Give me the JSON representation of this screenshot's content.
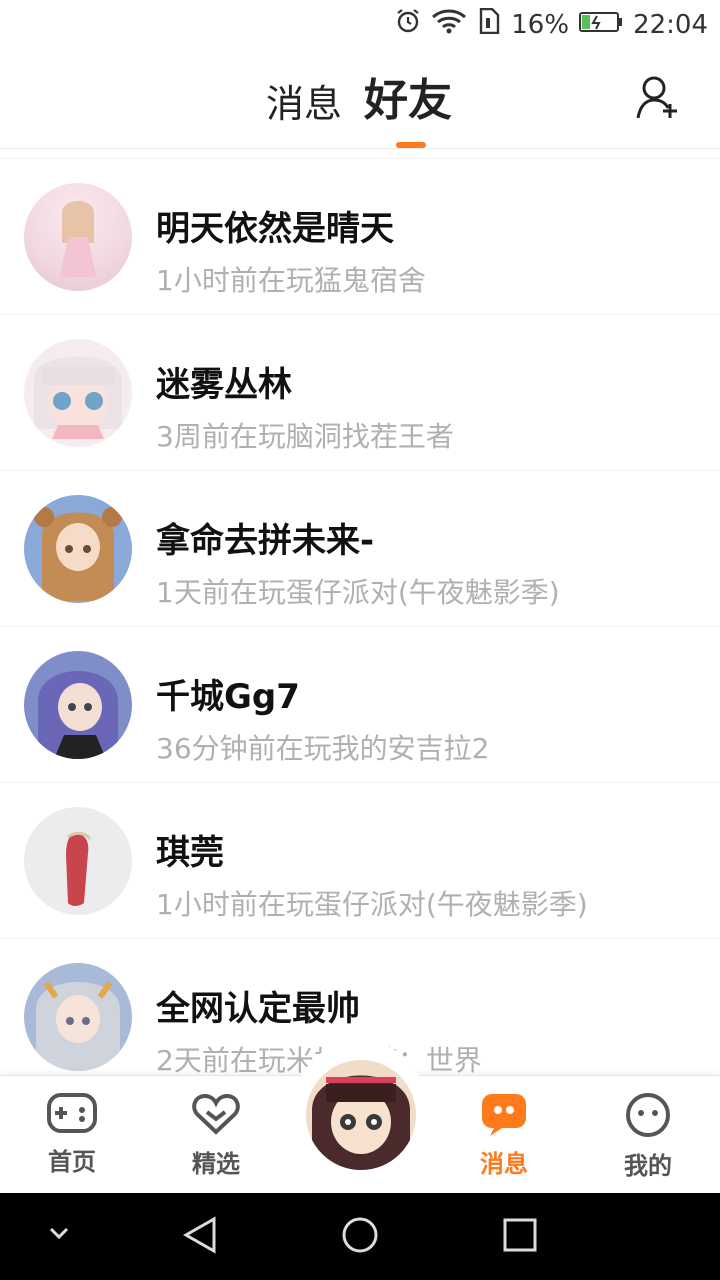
{
  "status_bar": {
    "battery": "16%",
    "time": "22:04",
    "icons": [
      "alarm-icon",
      "wifi-icon",
      "sim-icon",
      "battery-icon"
    ]
  },
  "header": {
    "tabs": [
      {
        "label": "消息"
      },
      {
        "label": "好友"
      }
    ],
    "active_tab": "好友",
    "add_friend_icon": "add-user-icon",
    "accent": "#ff7a1a"
  },
  "friends": [
    {
      "name": "明天依然是晴天",
      "status": "1小时前在玩猛鬼宿舍",
      "avatar_color": "#f2d9e1"
    },
    {
      "name": "迷雾丛林",
      "status": "3周前在玩脑洞找茬王者",
      "avatar_color": "#f1e7ea"
    },
    {
      "name": "拿命去拼未来-",
      "status": "1天前在玩蛋仔派对(午夜魅影季)",
      "avatar_color": "#8aa8d8"
    },
    {
      "name": "千城Gg7",
      "status": "36分钟前在玩我的安吉拉2",
      "avatar_color": "#7e86c6"
    },
    {
      "name": "琪莞",
      "status": "1小时前在玩蛋仔派对(午夜魅影季)",
      "avatar_color": "#e8e8ea"
    },
    {
      "name": "全网认定最帅",
      "status": "2天前在玩米加小镇：世界",
      "avatar_color": "#a9b9d8"
    }
  ],
  "tabbar": {
    "items": [
      {
        "label": "首页",
        "icon": "gamepad-icon"
      },
      {
        "label": "精选",
        "icon": "heart-icon"
      },
      {
        "label": "消息",
        "icon": "message-icon"
      },
      {
        "label": "我的",
        "icon": "face-icon"
      }
    ],
    "active": "消息"
  },
  "navbar": {
    "icons": [
      "chevron-down-icon",
      "back-icon",
      "home-icon",
      "recents-icon"
    ]
  }
}
